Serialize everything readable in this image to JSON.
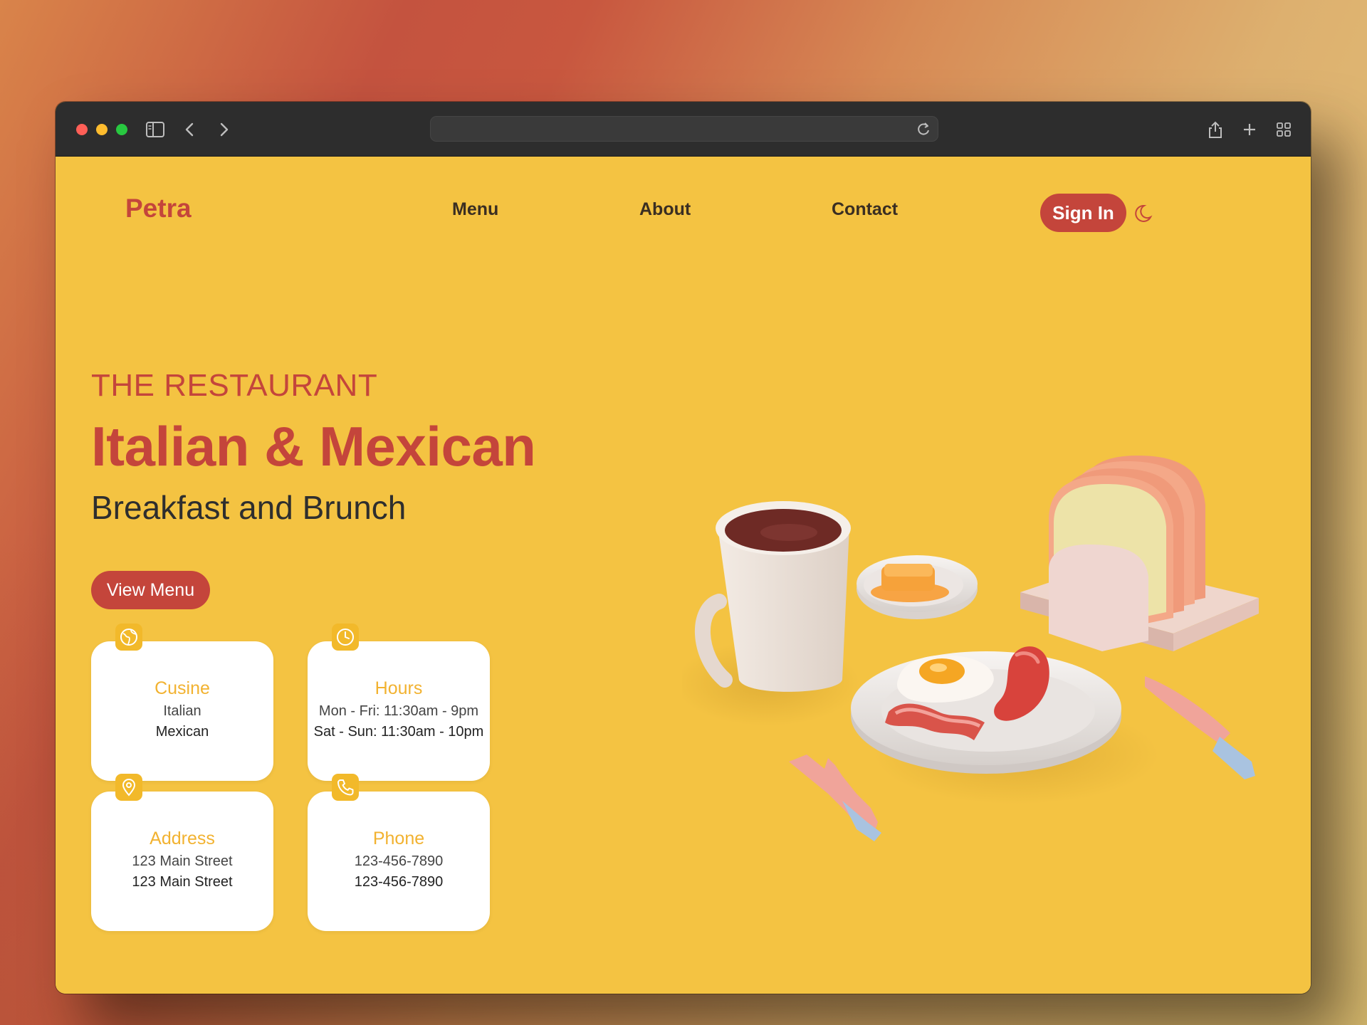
{
  "browser": {
    "address_value": ""
  },
  "header": {
    "brand": "Petra",
    "nav": [
      "Menu",
      "About",
      "Contact"
    ],
    "sign_in": "Sign In"
  },
  "hero": {
    "eyebrow": "THE RESTAURANT",
    "title": "Italian & Mexican",
    "subtitle": "Breakfast and Brunch",
    "cta": "View Menu"
  },
  "cards": [
    {
      "icon": "globe-icon",
      "title": "Cusine",
      "line1": "Italian",
      "line2": "Mexican"
    },
    {
      "icon": "clock-icon",
      "title": "Hours",
      "line1": "Mon - Fri: 11:30am - 9pm",
      "line2": "Sat - Sun: 11:30am - 10pm"
    },
    {
      "icon": "location-pin-icon",
      "title": "Address",
      "line1": "123 Main Street",
      "line2": "123 Main Street"
    },
    {
      "icon": "phone-icon",
      "title": "Phone",
      "line1": "123-456-7890",
      "line2": "123-456-7890"
    }
  ],
  "colors": {
    "page_background": "#f4c342",
    "accent": "#c4453b",
    "card_title": "#f2b230",
    "badge": "#f2b92a"
  }
}
